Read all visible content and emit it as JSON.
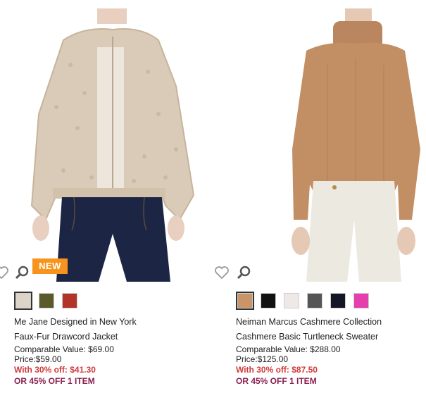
{
  "products": [
    {
      "badge": "NEW",
      "brand": "Me Jane Designed in New York",
      "name": "Faux-Fur Drawcord Jacket",
      "comparable": "Comparable Value: $69.00",
      "price": "Price:$59.00",
      "promo": "With 30% off: $41.30",
      "promo2": "OR 45% OFF 1 ITEM",
      "swatches": [
        "#ddd3c6",
        "#5b5a2c",
        "#b23328"
      ],
      "selected_swatch": 0
    },
    {
      "brand": "Neiman Marcus Cashmere Collection",
      "name": "Cashmere Basic Turtleneck Sweater",
      "comparable": "Comparable Value: $288.00",
      "price": "Price:$125.00",
      "promo": "With 30% off: $87.50",
      "promo2": "OR 45% OFF 1 ITEM",
      "swatches": [
        "#c89468",
        "#111111",
        "#eee9e6",
        "#555555",
        "#141527",
        "#e53fad"
      ],
      "selected_swatch": 0
    }
  ],
  "icons": {
    "quick_view": "magnifier-icon",
    "wishlist": "heart-icon"
  }
}
